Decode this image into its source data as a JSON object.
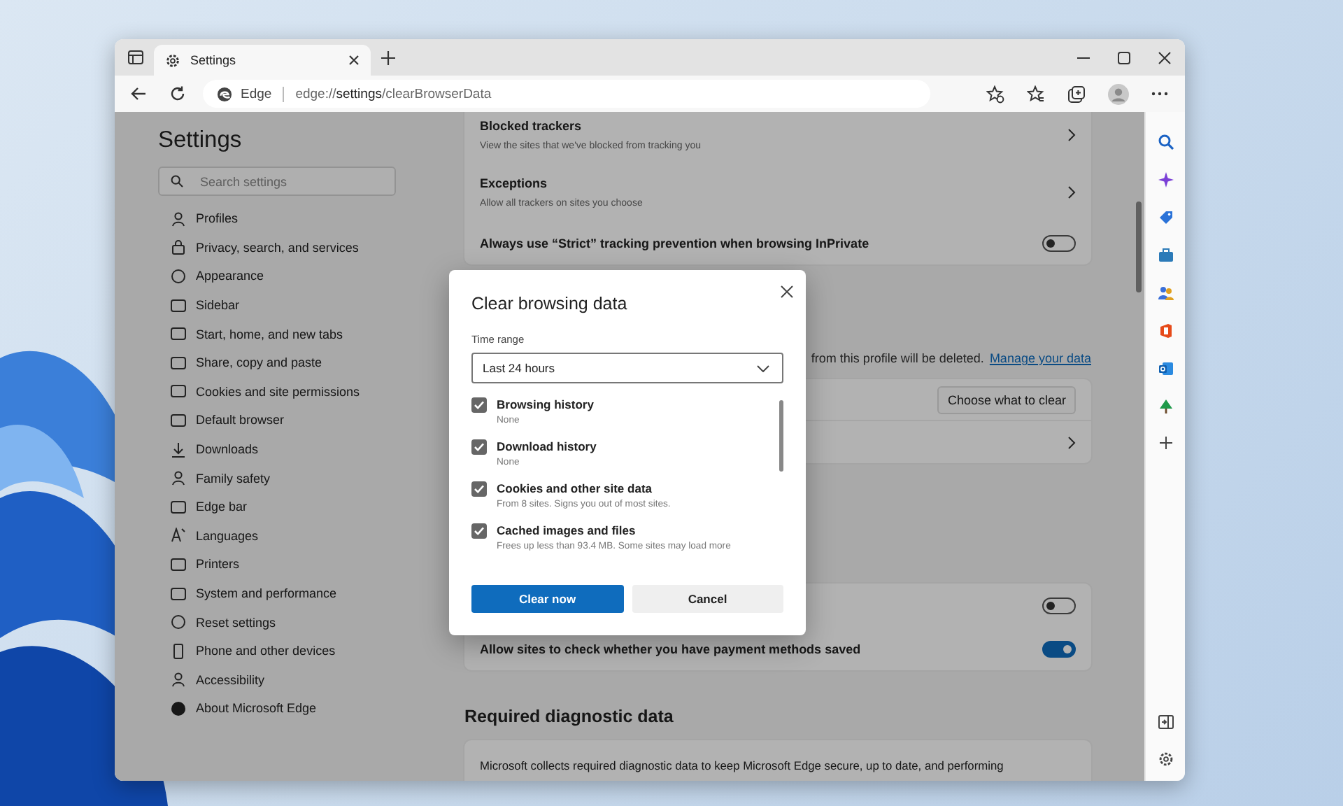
{
  "browser": {
    "tab": {
      "title": "Settings"
    },
    "address": {
      "site_label": "Edge",
      "url": "edge://**settings**/clearBrowserData"
    }
  },
  "settings_nav": {
    "title": "Settings",
    "search_placeholder": "Search settings",
    "items": [
      {
        "label": "Profiles",
        "selected": false
      },
      {
        "label": "Privacy, search, and services",
        "selected": false
      },
      {
        "label": "Appearance",
        "selected": false
      },
      {
        "label": "Sidebar",
        "selected": false
      },
      {
        "label": "Start, home, and new tabs",
        "selected": false
      },
      {
        "label": "Share, copy and paste",
        "selected": false
      },
      {
        "label": "Cookies and site permissions",
        "selected": false
      },
      {
        "label": "Default browser",
        "selected": false
      },
      {
        "label": "Downloads",
        "selected": false
      },
      {
        "label": "Family safety",
        "selected": false
      },
      {
        "label": "Edge bar",
        "selected": false
      },
      {
        "label": "Languages",
        "selected": false
      },
      {
        "label": "Printers",
        "selected": false
      },
      {
        "label": "System and performance",
        "selected": false
      },
      {
        "label": "Reset settings",
        "selected": false
      },
      {
        "label": "Phone and other devices",
        "selected": false
      },
      {
        "label": "Accessibility",
        "selected": false
      },
      {
        "label": "About Microsoft Edge",
        "selected": false
      }
    ]
  },
  "content": {
    "tracking_card": {
      "rows": [
        {
          "kind": "link",
          "title": "Blocked trackers",
          "subtitle": "View the sites that we've blocked from tracking you"
        },
        {
          "kind": "link",
          "title": "Exceptions",
          "subtitle": "Allow all trackers on sites you choose"
        },
        {
          "kind": "toggle",
          "title": "Always use “Strict” tracking prevention when browsing InPrivate",
          "on": false
        }
      ]
    },
    "clear_note": {
      "text": "from this profile will be deleted.",
      "link": "Manage your data"
    },
    "clear_card": {
      "rows": [
        {
          "kind": "button",
          "button": "Choose what to clear"
        },
        {
          "kind": "link"
        }
      ]
    },
    "payment_card": {
      "rows": [
        {
          "kind": "toggle",
          "on": false
        },
        {
          "kind": "toggle",
          "title": "Allow sites to check whether you have payment methods saved",
          "on": true
        }
      ]
    },
    "diagnostic": {
      "heading": "Required diagnostic data",
      "text": "Microsoft collects required diagnostic data to keep Microsoft Edge secure, up to date, and performing"
    }
  },
  "dialog": {
    "title": "Clear browsing data",
    "time_range": {
      "label": "Time range",
      "value": "Last 24 hours"
    },
    "options": [
      {
        "label": "Browsing history",
        "detail": "None",
        "checked": true
      },
      {
        "label": "Download history",
        "detail": "None",
        "checked": true
      },
      {
        "label": "Cookies and other site data",
        "detail": "From 8 sites. Signs you out of most sites.",
        "checked": true
      },
      {
        "label": "Cached images and files",
        "detail": "Frees up less than 93.4 MB. Some sites may load more",
        "checked": true
      }
    ],
    "buttons": [
      {
        "label": "Clear now",
        "kind": "primary"
      },
      {
        "label": "Cancel",
        "kind": "secondary"
      }
    ]
  }
}
